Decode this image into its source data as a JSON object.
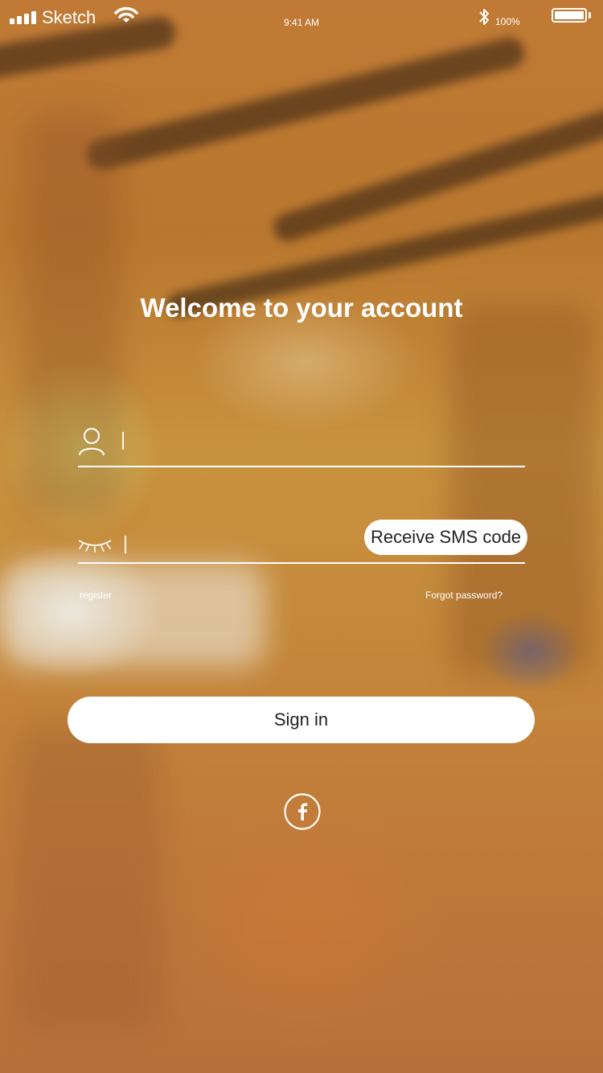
{
  "status_bar": {
    "carrier": "Sketch",
    "time": "9:41 AM",
    "battery_percent": "100%"
  },
  "login": {
    "title": "Welcome to your account",
    "username": {
      "value": "",
      "placeholder": ""
    },
    "password": {
      "value": "",
      "placeholder": ""
    },
    "sms_button_label": "Receive SMS code",
    "register_label": "register",
    "forgot_label": "Forgot password?",
    "signin_label": "Sign in"
  },
  "icons": {
    "status": [
      "signal-icon",
      "wifi-icon",
      "bluetooth-icon",
      "battery-icon"
    ],
    "fields": [
      "user-icon",
      "closed-eye-icon"
    ],
    "social": [
      "facebook-icon"
    ]
  },
  "colors": {
    "text": "#FFFFFF",
    "button_bg": "#FFFFFF",
    "button_text": "#222222"
  }
}
